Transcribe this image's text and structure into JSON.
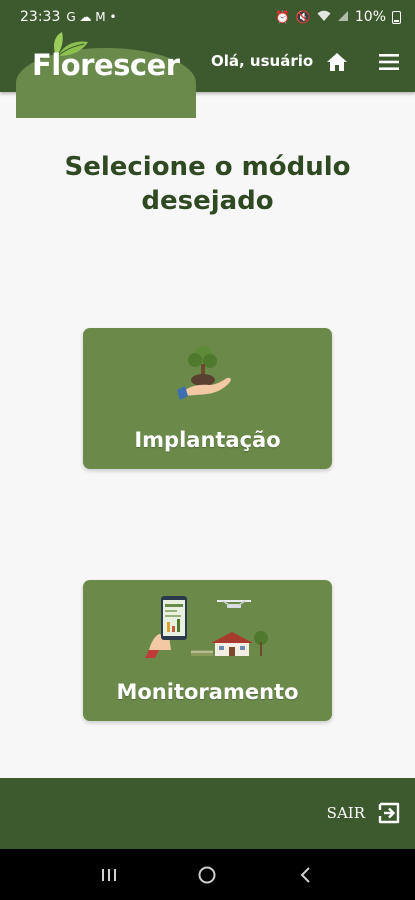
{
  "status_bar": {
    "time": "23:33",
    "left_indicators": "G ☁ M •",
    "battery": "10%"
  },
  "header": {
    "logo_text": "Florescer",
    "greeting": "Olá, usuário",
    "home_icon": "home-icon",
    "menu_icon": "menu-icon"
  },
  "main": {
    "title": "Selecione o módulo desejado",
    "modules": [
      {
        "label": "Implantação",
        "icon": "hand-with-tree-icon"
      },
      {
        "label": "Monitoramento",
        "icon": "phone-drone-farm-icon"
      }
    ]
  },
  "footer": {
    "logout_label": "SAIR",
    "logout_icon": "exit-icon"
  },
  "colors": {
    "primary_dark": "#3d5a2e",
    "card_green": "#6b8a4a",
    "title_green": "#2f4a22",
    "background": "#f7f7f7"
  }
}
